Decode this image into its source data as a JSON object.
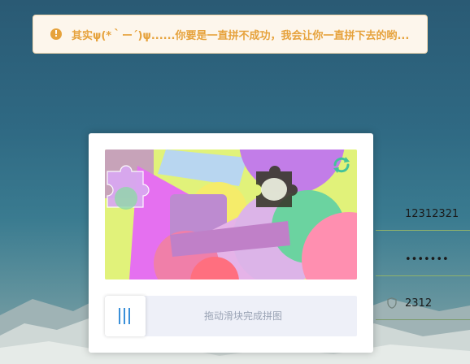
{
  "toast": {
    "icon": "warning-icon",
    "message": "其实ψ(*｀ー´)ψ......你要是一直拼不成功，我会让你一直拼下去的哟..."
  },
  "login": {
    "username_value": "12312321",
    "password_value": "•••••••",
    "code_value": "2312"
  },
  "captcha": {
    "refresh_icon": "refresh-icon",
    "slider_hint": "拖动滑块完成拼图",
    "slider_icon": "drag-bars-icon",
    "colors": {
      "accent": "#3a90d9",
      "track": "#eef0f8",
      "warning": "#e6a23c"
    }
  }
}
